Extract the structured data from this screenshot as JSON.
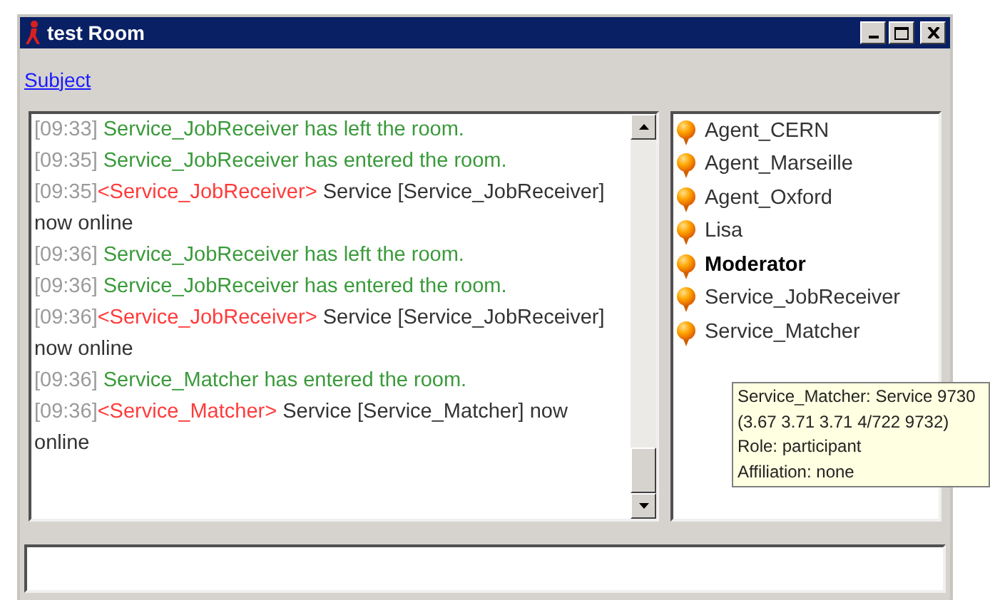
{
  "window": {
    "title": "test Room"
  },
  "subject_link": "Subject",
  "messages": [
    {
      "kind": "event",
      "time": "[09:33]",
      "text": "Service_JobReceiver has left the room."
    },
    {
      "kind": "event",
      "time": "[09:35]",
      "text": "Service_JobReceiver has entered the room."
    },
    {
      "kind": "message",
      "time": "[09:35]",
      "sender": "<Service_JobReceiver>",
      "text": "Service [Service_JobReceiver] now online"
    },
    {
      "kind": "event",
      "time": "[09:36]",
      "text": "Service_JobReceiver has left the room."
    },
    {
      "kind": "event",
      "time": "[09:36]",
      "text": "Service_JobReceiver has entered the room."
    },
    {
      "kind": "message",
      "time": "[09:36]",
      "sender": "<Service_JobReceiver>",
      "text": "Service [Service_JobReceiver] now online"
    },
    {
      "kind": "event",
      "time": "[09:36]",
      "text": "Service_Matcher has entered the room."
    },
    {
      "kind": "message",
      "time": "[09:36]",
      "sender": "<Service_Matcher>",
      "text": "Service [Service_Matcher] now online"
    }
  ],
  "participants": [
    {
      "name": "Agent_CERN",
      "moderator": false
    },
    {
      "name": "Agent_Marseille",
      "moderator": false
    },
    {
      "name": "Agent_Oxford",
      "moderator": false
    },
    {
      "name": "Lisa",
      "moderator": false
    },
    {
      "name": "Moderator",
      "moderator": true
    },
    {
      "name": "Service_JobReceiver",
      "moderator": false
    },
    {
      "name": "Service_Matcher",
      "moderator": false
    }
  ],
  "tooltip": {
    "lines": [
      "Service_Matcher: Service 9730 (3.67 3.71 3.71 4/722 9732)",
      "Role: participant",
      "Affiliation: none"
    ]
  }
}
